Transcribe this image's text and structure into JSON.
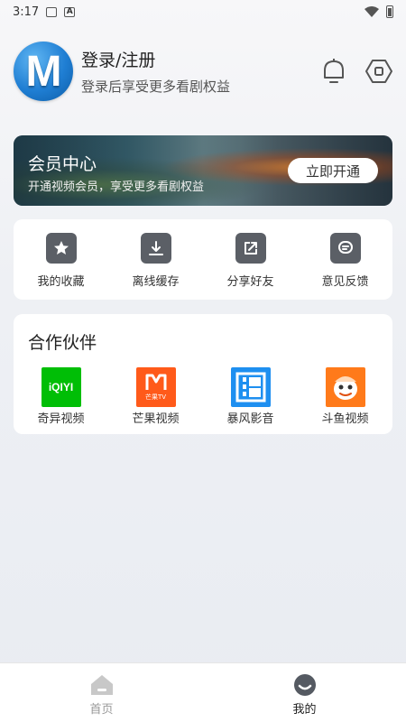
{
  "status_bar": {
    "time": "3:17",
    "icons": [
      "image-notification-icon",
      "a-notification-icon",
      "wifi-icon",
      "battery-icon"
    ]
  },
  "profile": {
    "avatar_letter": "M",
    "title": "登录/注册",
    "subtitle": "登录后享受更多看剧权益",
    "icons": [
      "bell-icon",
      "settings-icon"
    ]
  },
  "vip": {
    "title": "会员中心",
    "subtitle": "开通视频会员，享受更多看剧权益",
    "button": "立即开通"
  },
  "actions": [
    {
      "label": "我的收藏",
      "icon": "star-icon"
    },
    {
      "label": "离线缓存",
      "icon": "download-icon"
    },
    {
      "label": "分享好友",
      "icon": "share-icon"
    },
    {
      "label": "意见反馈",
      "icon": "feedback-icon"
    }
  ],
  "partners": {
    "title": "合作伙伴",
    "items": [
      {
        "label": "奇异视频",
        "logo_text": "iQIYI",
        "color": "#00be06"
      },
      {
        "label": "芒果视频",
        "logo_text": "芒果TV",
        "color": "#ff5a1a"
      },
      {
        "label": "暴风影音",
        "logo_text": "",
        "color": "#1e8ff0"
      },
      {
        "label": "斗鱼视频",
        "logo_text": "",
        "color": "#ff7a1a"
      }
    ]
  },
  "bottom_nav": [
    {
      "label": "首页",
      "active": false
    },
    {
      "label": "我的",
      "active": true
    }
  ]
}
